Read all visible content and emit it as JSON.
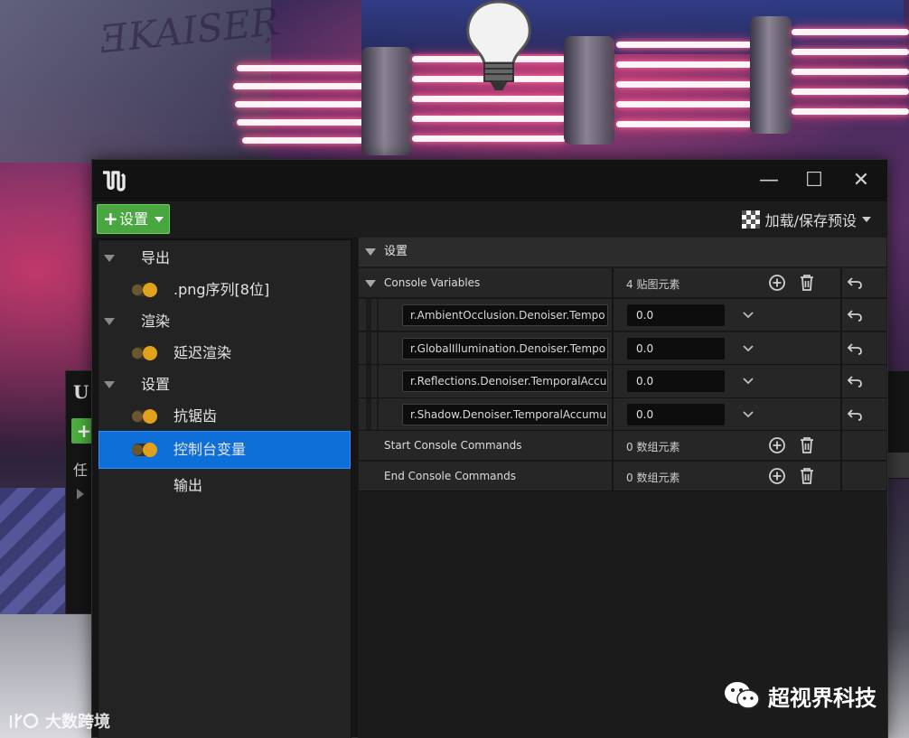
{
  "window": {
    "controls": {
      "minimize": "—",
      "maximize": "☐",
      "close": "✕"
    }
  },
  "toolbar": {
    "add_label": "设置",
    "preset_label": "加载/保存预设"
  },
  "sidebar": {
    "items": [
      {
        "label": "导出",
        "type": "category"
      },
      {
        "label": ".png序列[8位]",
        "type": "setting",
        "enabled": true
      },
      {
        "label": "渲染",
        "type": "category"
      },
      {
        "label": "延迟渲染",
        "type": "setting",
        "enabled": true
      },
      {
        "label": "设置",
        "type": "category"
      },
      {
        "label": "抗锯齿",
        "type": "setting",
        "enabled": true
      },
      {
        "label": "控制台变量",
        "type": "setting",
        "enabled": true,
        "selected": true
      },
      {
        "label": "输出",
        "type": "setting"
      }
    ]
  },
  "details": {
    "section_title": "设置",
    "console_variables": {
      "name": "Console Variables",
      "summary": "4 贴图元素",
      "entries": [
        {
          "key": "r.AmbientOcclusion.Denoiser.Tempo",
          "value": "0.0"
        },
        {
          "key": "r.GlobalIllumination.Denoiser.Tempo",
          "value": "0.0"
        },
        {
          "key": "r.Reflections.Denoiser.TemporalAccu",
          "value": "0.0"
        },
        {
          "key": "r.Shadow.Denoiser.TemporalAccumu",
          "value": "0.0"
        }
      ]
    },
    "start_commands": {
      "name": "Start Console Commands",
      "summary": "0 数组元素"
    },
    "end_commands": {
      "name": "End Console Commands",
      "summary": "0 数组元素"
    }
  },
  "back_window": {
    "partial_label": "任"
  },
  "watermarks": {
    "left": "大数跨境",
    "right": "超视界科技"
  },
  "colors": {
    "accent_green": "#49a73f",
    "selection_blue": "#0f6fd8",
    "toggle_on": "#e0a21c"
  }
}
